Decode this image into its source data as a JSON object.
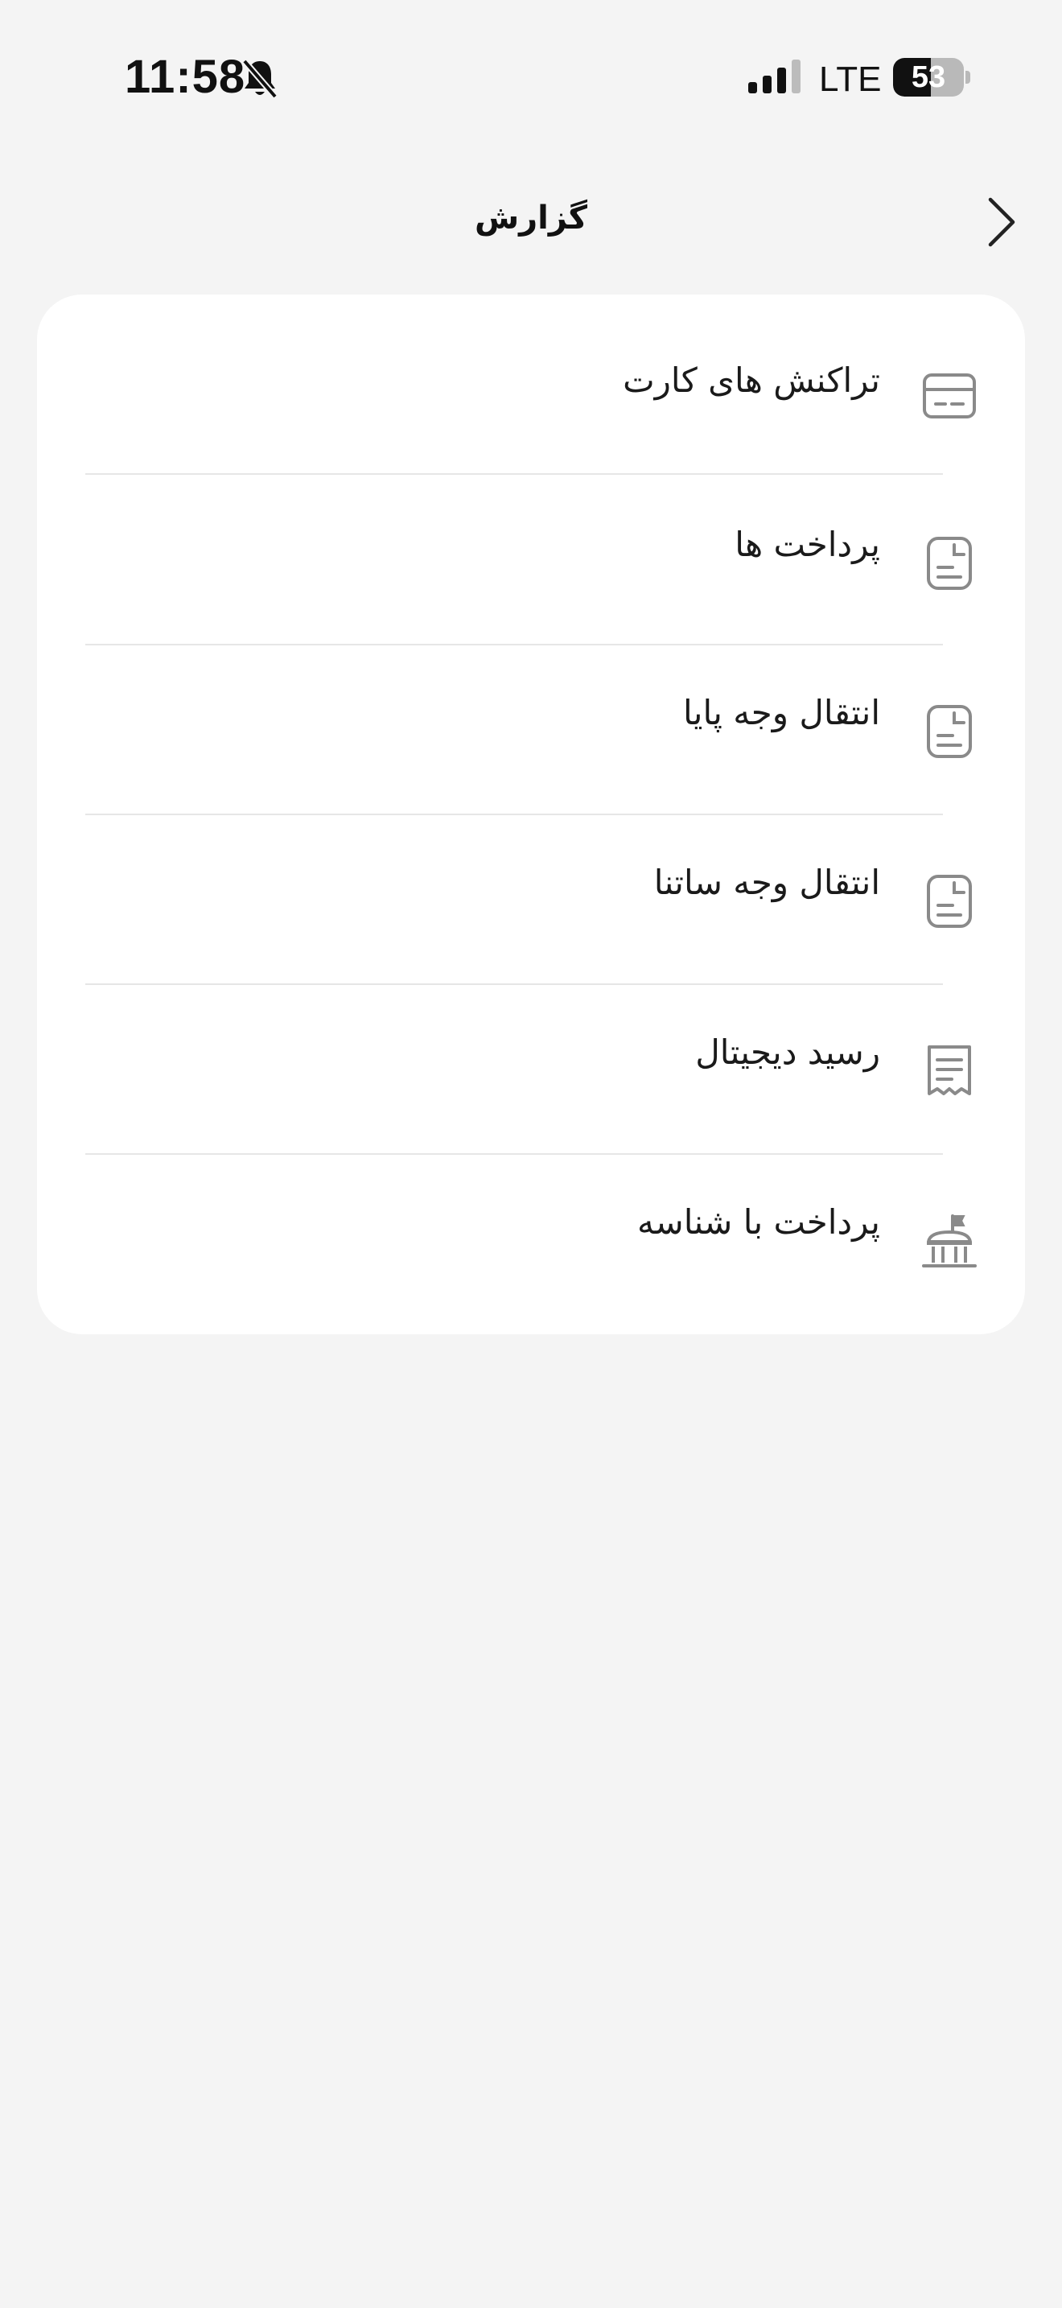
{
  "status_bar": {
    "time": "11:58",
    "network": "LTE",
    "battery_level": "53",
    "battery_percent": 53,
    "icons": [
      "bell-slash-icon",
      "signal-icon",
      "battery-icon"
    ]
  },
  "header": {
    "title": "گزارش",
    "back_icon": "chevron-right-icon"
  },
  "menu": {
    "items": [
      {
        "label": "تراکنش های کارت",
        "icon": "card-icon"
      },
      {
        "label": "پرداخت ها",
        "icon": "document-icon"
      },
      {
        "label": "انتقال وجه پایا",
        "icon": "document-icon"
      },
      {
        "label": "انتقال وجه ساتنا",
        "icon": "document-icon"
      },
      {
        "label": "رسید دیجیتال",
        "icon": "receipt-icon"
      },
      {
        "label": "پرداخت با شناسه",
        "icon": "bank-icon"
      }
    ]
  },
  "colors": {
    "background": "#f4f4f4",
    "card": "#ffffff",
    "icon": "#8a8a8a",
    "divider": "#e6e6e6",
    "text": "#1a1a1a"
  }
}
